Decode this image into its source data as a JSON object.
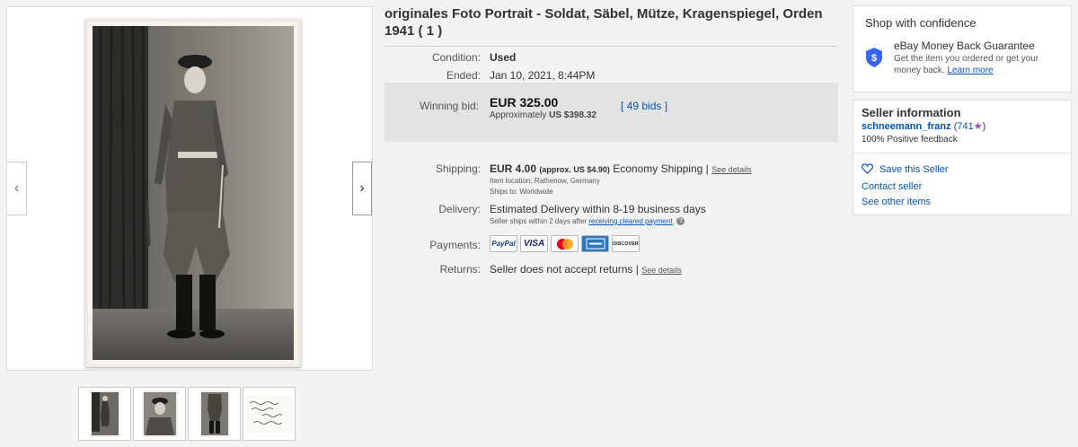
{
  "listing": {
    "title": "originales Foto Portrait - Soldat, Säbel, Mütze, Kragenspiegel, Orden 1941 ( 1 )",
    "condition_label": "Condition:",
    "condition_value": "Used",
    "ended_label": "Ended:",
    "ended_value": "Jan 10, 2021, 8:44PM",
    "bid_label": "Winning bid:",
    "bid_value": "EUR 325.00",
    "bid_approx_prefix": "Approximately",
    "bid_approx_value": "US $398.32",
    "bids_link": "[ 49 bids ]",
    "shipping_label": "Shipping:",
    "shipping_value": "EUR 4.00",
    "shipping_approx": "(approx. US $4.90)",
    "shipping_method": "Economy Shipping",
    "shipping_see_details": "See details",
    "item_location": "Item location:  Rathenow, Germany",
    "ships_to": "Ships to:  Worldwide",
    "delivery_label": "Delivery:",
    "delivery_value": "Estimated Delivery within 8-19 business days",
    "delivery_sub_prefix": "Seller ships within 2 days after",
    "delivery_sub_link": "receiving cleared payment",
    "payments_label": "Payments:",
    "payment_methods": [
      "PayPal",
      "VISA",
      "Mastercard",
      "AMEX",
      "DISCOVER"
    ],
    "returns_label": "Returns:",
    "returns_value": "Seller does not accept returns",
    "returns_see_details": "See details"
  },
  "confidence": {
    "heading": "Shop with confidence",
    "guarantee_title": "eBay Money Back Guarantee",
    "guarantee_text_1": "Get the item you ordered or get your",
    "guarantee_text_2": "money back.",
    "learn_more": "Learn more"
  },
  "seller": {
    "heading": "Seller information",
    "name": "schneemann_franz",
    "feedback_count": "(741",
    "feedback_close": ")",
    "positive": "100% Positive feedback",
    "save": "Save this Seller",
    "contact": "Contact seller",
    "other_items": "See other items"
  },
  "gallery": {
    "thumbnail_count": 4
  },
  "colors": {
    "link": "#0654ba",
    "star": "#a142b5",
    "bid_box": "#e3e3e3"
  }
}
